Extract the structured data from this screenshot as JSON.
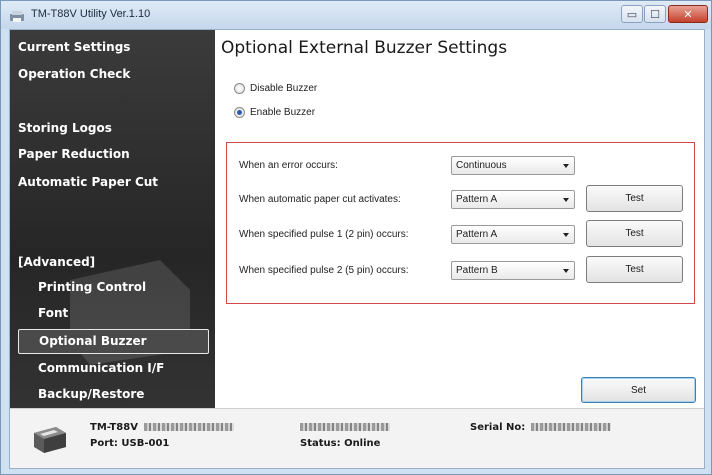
{
  "window": {
    "title": "TM-T88V Utility Ver.1.10",
    "controls": {
      "minimize": "▭",
      "maximize": "☐",
      "close": "✕"
    }
  },
  "sidebar": {
    "items": [
      {
        "label": "Current Settings",
        "level": "top"
      },
      {
        "label": "Operation Check",
        "level": "top"
      },
      {
        "label": "Storing Logos",
        "level": "top"
      },
      {
        "label": "Paper Reduction",
        "level": "top"
      },
      {
        "label": "Automatic Paper Cut",
        "level": "top"
      },
      {
        "label": "[Advanced]",
        "level": "header"
      },
      {
        "label": "Printing Control",
        "level": "sub"
      },
      {
        "label": "Font",
        "level": "sub"
      },
      {
        "label": "Optional Buzzer",
        "level": "sub",
        "selected": true
      },
      {
        "label": "Communication I/F",
        "level": "sub"
      },
      {
        "label": "Backup/Restore",
        "level": "sub"
      }
    ]
  },
  "main": {
    "title": "Optional External Buzzer Settings",
    "radios": [
      {
        "label": "Disable Buzzer",
        "checked": false
      },
      {
        "label": "Enable Buzzer",
        "checked": true
      }
    ],
    "settings": [
      {
        "label": "When an error occurs:",
        "value": "Continuous",
        "test": ""
      },
      {
        "label": "When automatic paper cut activates:",
        "value": "Pattern A",
        "test": "Test"
      },
      {
        "label": "When specified pulse 1 (2 pin) occurs:",
        "value": "Pattern A",
        "test": "Test"
      },
      {
        "label": "When specified pulse 2 (5 pin) occurs:",
        "value": "Pattern B",
        "test": "Test"
      }
    ],
    "set_label": "Set"
  },
  "status": {
    "model": "TM-T88V",
    "port": "Port: USB-001",
    "status": "Status: Online",
    "serial_label": "Serial No:"
  },
  "colors": {
    "sidebar_bg": "#2b2b2b",
    "highlight_border": "#d04848",
    "set_button_focus": "#3c7fb1"
  }
}
